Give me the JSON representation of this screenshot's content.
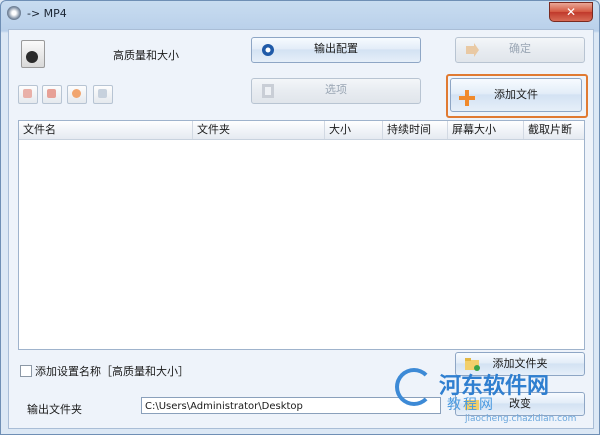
{
  "window": {
    "title": "-> MP4",
    "close_glyph": "✕"
  },
  "profile": {
    "label": "高质量和大小",
    "icon": "mp4-file-icon"
  },
  "toolbar": {
    "output_config": "输出配置",
    "ok": "确定",
    "options": "选项",
    "add_file": "添加文件",
    "add_folder": "添加文件夹",
    "change": "改变"
  },
  "table": {
    "columns": [
      "文件名",
      "文件夹",
      "大小",
      "持续时间",
      "屏幕大小",
      "截取片断"
    ],
    "rows": []
  },
  "settings": {
    "add_setting_name": "添加设置名称［高质量和大小］"
  },
  "output": {
    "label": "输出文件夹",
    "path": "C:\\Users\\Administrator\\Desktop"
  },
  "watermark": {
    "title": "河东软件网",
    "subtitle": "教程网",
    "url": "jiaocheng.chazidian.com"
  },
  "colors": {
    "accent_orange": "#e07a32",
    "highlight_border": "#e07a32",
    "watermark_blue": "#2f7fd0"
  }
}
